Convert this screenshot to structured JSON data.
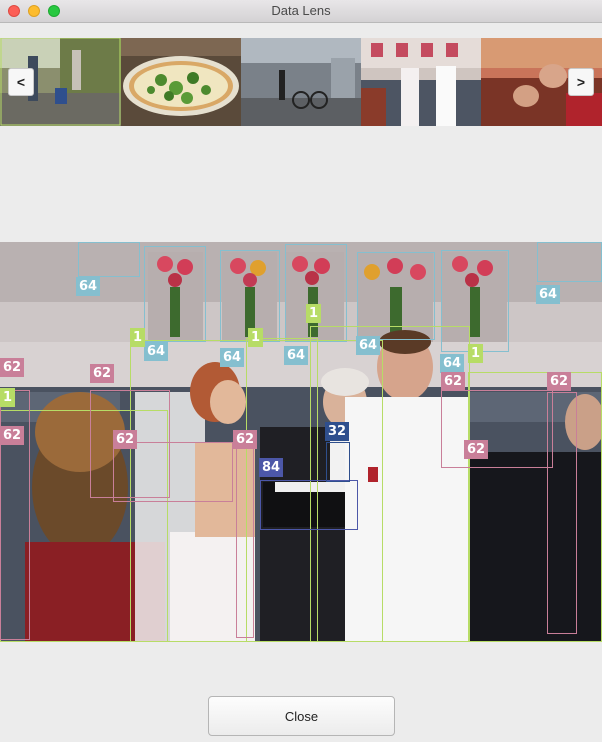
{
  "window": {
    "title": "Data Lens"
  },
  "thumbnails": {
    "prev_label": "<",
    "next_label": ">",
    "items": [
      "street-scene",
      "pizza",
      "bikes-hallway",
      "wedding",
      "people-resting"
    ]
  },
  "viewer": {
    "labels": [
      "64",
      "64",
      "64",
      "64",
      "64",
      "64",
      "64",
      "64",
      "1",
      "1",
      "1",
      "1",
      "1",
      "62",
      "62",
      "62",
      "62",
      "62",
      "62",
      "62",
      "62",
      "32",
      "84"
    ]
  },
  "footer": {
    "close_label": "Close"
  },
  "colors": {
    "cat64": "#85bfcf",
    "cat1": "#b7dc66",
    "cat62": "#c97f99",
    "cat32": "#2f4f8d",
    "cat84": "#4c57a8"
  }
}
